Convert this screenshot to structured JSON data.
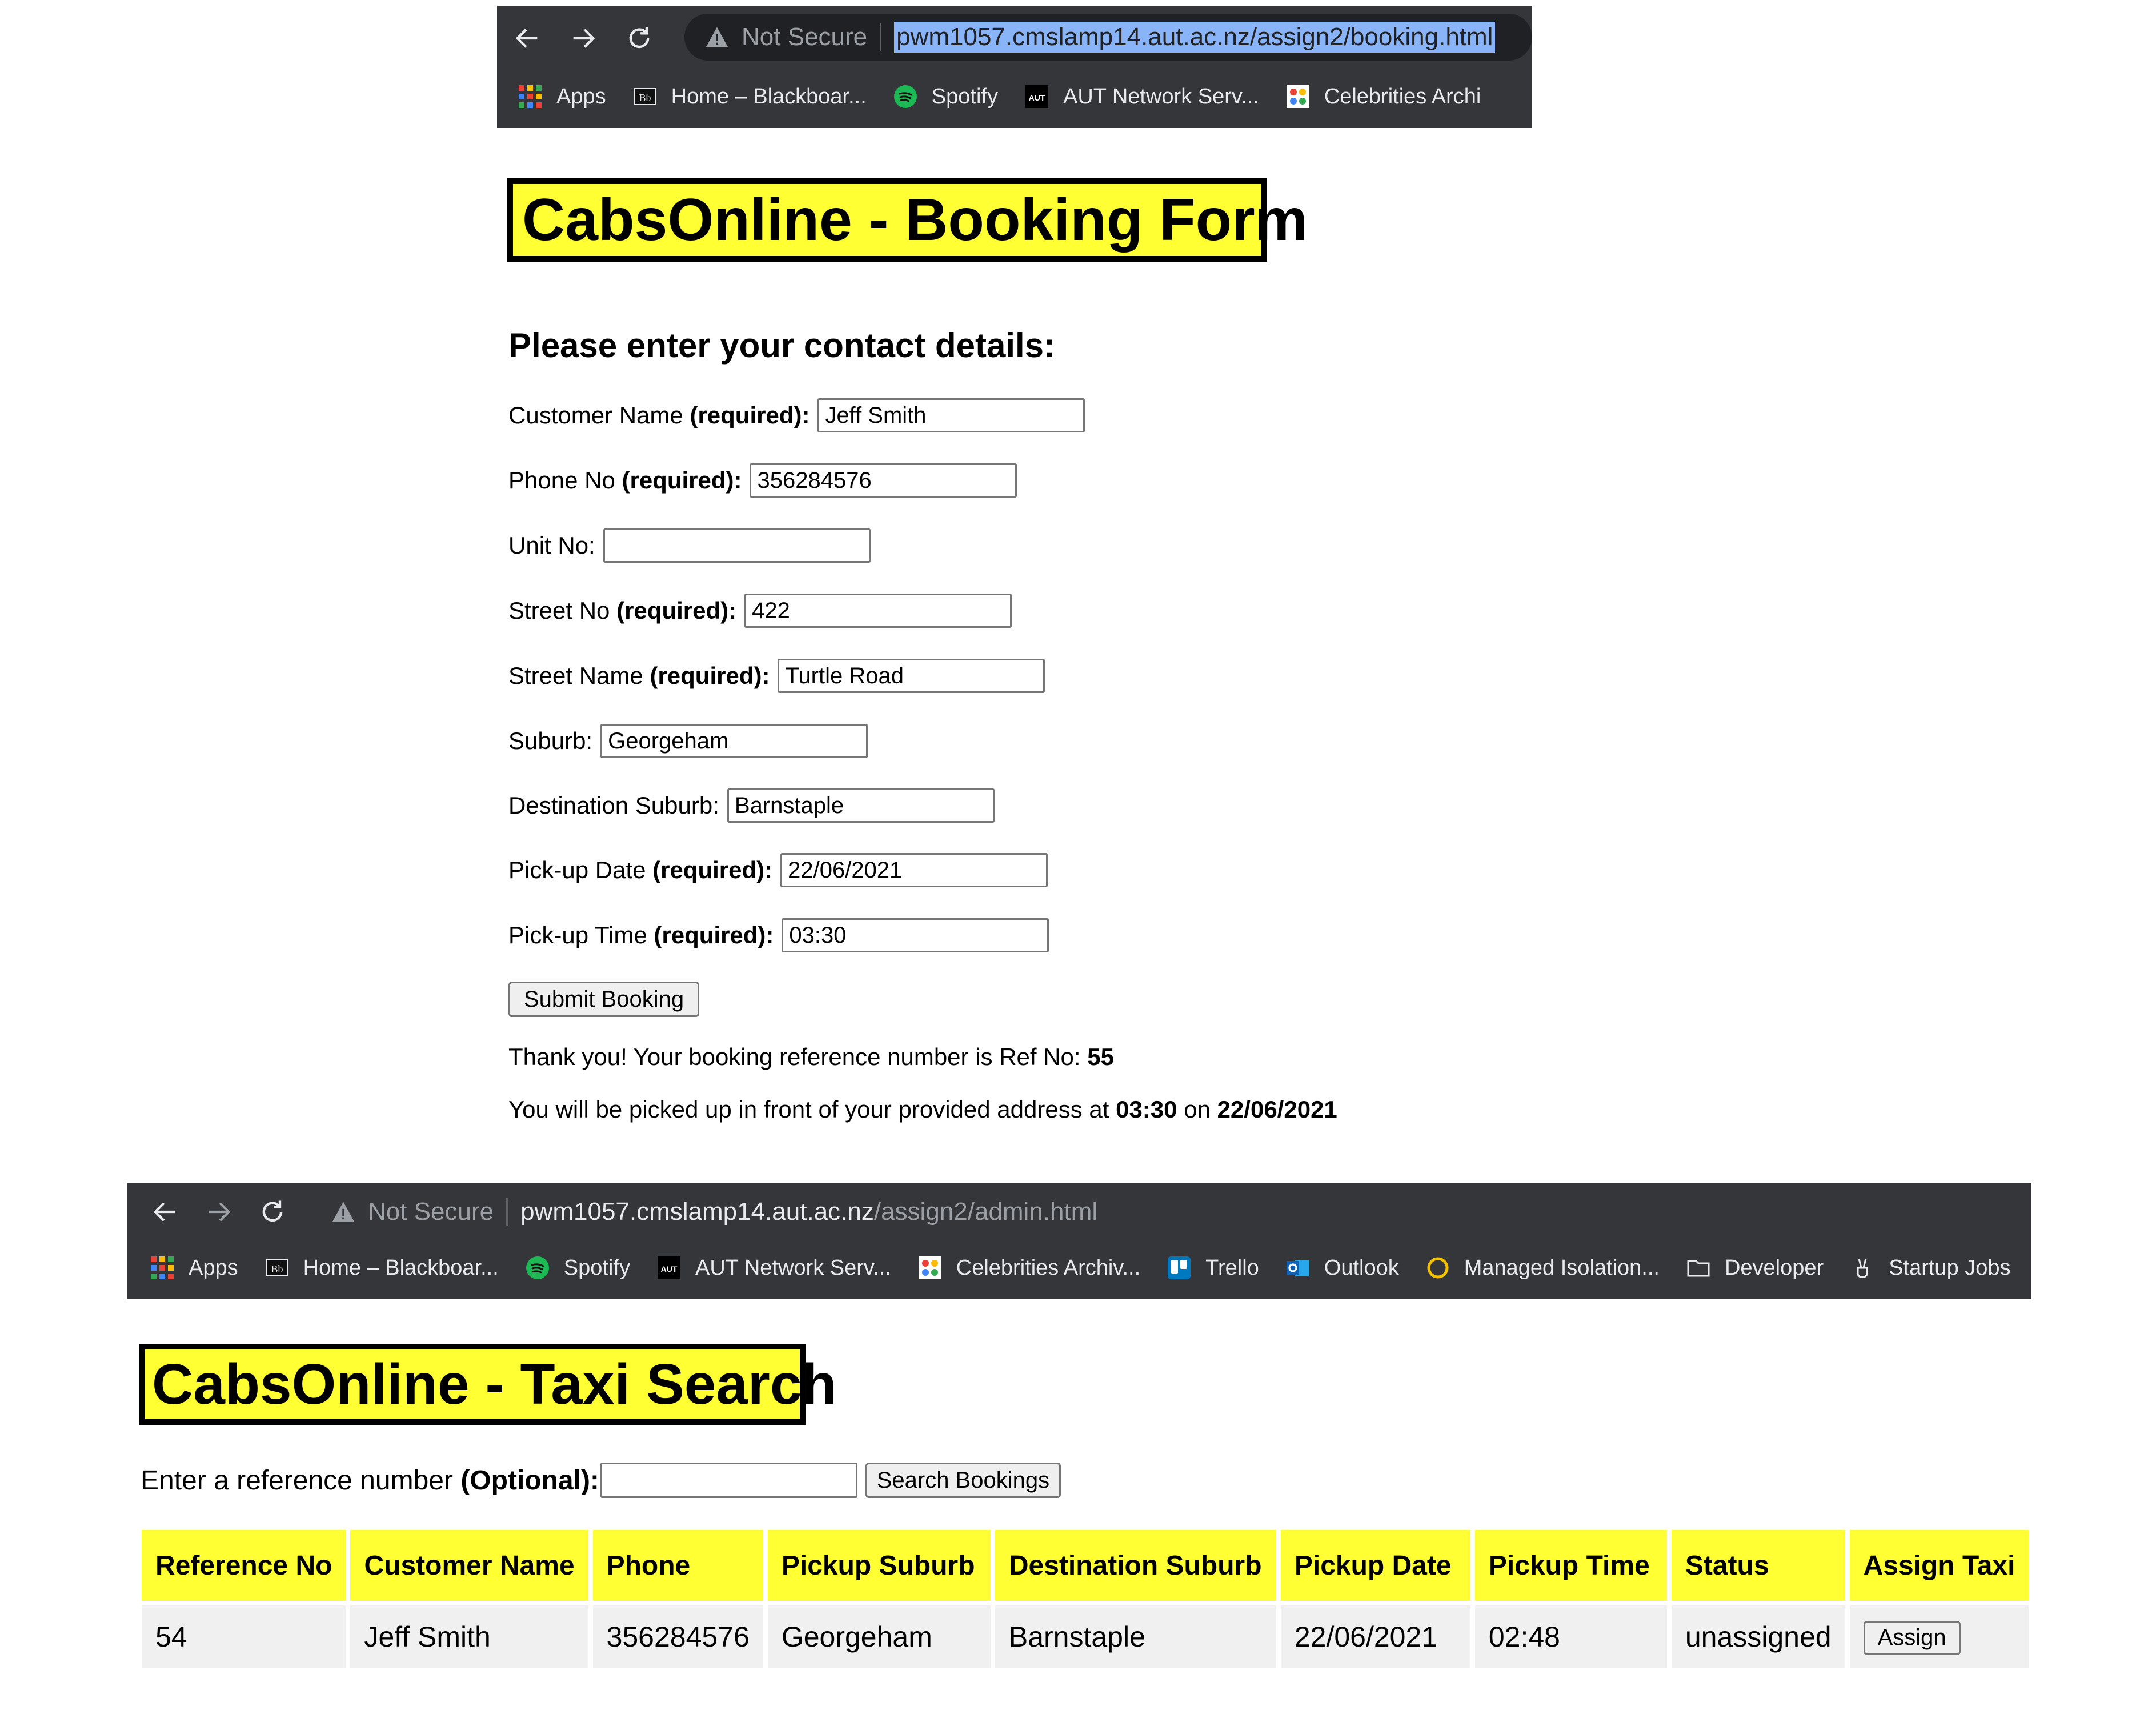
{
  "booking_browser": {
    "not_secure": "Not Secure",
    "url": "pwm1057.cmslamp14.aut.ac.nz/assign2/booking.html",
    "bookmarks": [
      "Apps",
      "Home – Blackboar...",
      "Spotify",
      "AUT Network Serv...",
      "Celebrities Archi"
    ]
  },
  "booking_page": {
    "title": "CabsOnline - Booking Form",
    "heading": "Please enter your contact details:",
    "required": "(required):",
    "fields": [
      {
        "label": "Customer Name",
        "value": "Jeff Smith"
      },
      {
        "label": "Phone No",
        "value": "356284576"
      },
      {
        "label": "Unit No:",
        "value": ""
      },
      {
        "label": "Street No",
        "value": "422"
      },
      {
        "label": "Street Name",
        "value": "Turtle Road"
      },
      {
        "label": "Suburb:",
        "value": "Georgeham"
      },
      {
        "label": "Destination Suburb:",
        "value": "Barnstaple"
      },
      {
        "label": "Pick-up Date",
        "value": "22/06/2021"
      },
      {
        "label": "Pick-up Time",
        "value": "03:30"
      }
    ],
    "submit_label": "Submit Booking",
    "confirm_text": "Thank you! Your booking reference number is Ref No:",
    "ref_no": "55",
    "pickup_text_1": "You will be picked up in front of your provided address at",
    "pickup_time": "03:30",
    "pickup_on": "on",
    "pickup_date": "22/06/2021"
  },
  "admin_browser": {
    "not_secure": "Not Secure",
    "url_host": "pwm1057.cmslamp14.aut.ac.nz",
    "url_path": "/assign2/admin.html",
    "bookmarks": [
      "Apps",
      "Home – Blackboar...",
      "Spotify",
      "AUT Network Serv...",
      "Celebrities Archiv...",
      "Trello",
      "Outlook",
      "Managed Isolation...",
      "Developer",
      "Startup Jobs"
    ]
  },
  "admin_page": {
    "title": "CabsOnline - Taxi Search",
    "search_label": "Enter a reference number",
    "search_optional": "(Optional):",
    "search_value": "",
    "search_button": "Search Bookings",
    "columns": [
      "Reference No",
      "Customer Name",
      "Phone",
      "Pickup Suburb",
      "Destination Suburb",
      "Pickup Date",
      "Pickup Time",
      "Status",
      "Assign Taxi"
    ],
    "rows": [
      {
        "ref": "54",
        "name": "Jeff Smith",
        "phone": "356284576",
        "pickup_suburb": "Georgeham",
        "dest_suburb": "Barnstaple",
        "date": "22/06/2021",
        "time": "02:48",
        "status": "unassigned",
        "action": "Assign"
      }
    ]
  },
  "colors": {
    "accent_yellow": "#ffff33",
    "chrome_dark": "#35363a"
  }
}
